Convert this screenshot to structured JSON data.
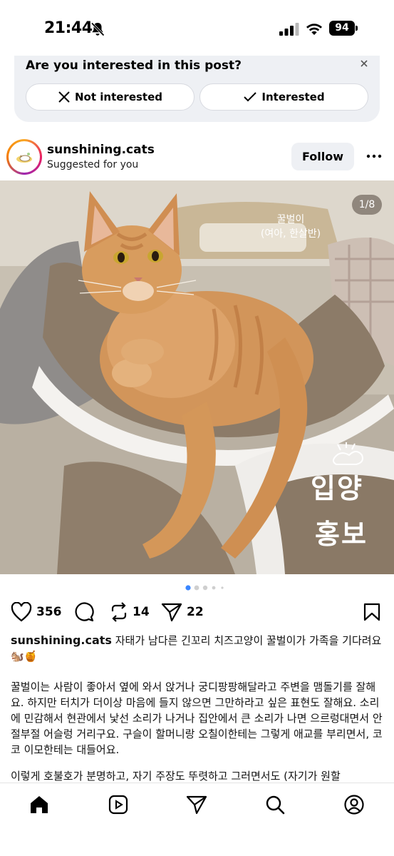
{
  "status_bar": {
    "time": "21:44",
    "battery": "94"
  },
  "interest_prompt": {
    "question": "Are you interested in this post?",
    "not_interested_label": "Not interested",
    "interested_label": "Interested"
  },
  "post": {
    "username": "sunshining.cats",
    "subtitle": "Suggested for you",
    "follow_label": "Follow",
    "image_counter": "1/8",
    "image_overlay": {
      "name_line1": "꿀벌이",
      "name_line2": "(여아, 한살반)",
      "tag_line1": "입양",
      "tag_line2": "홍보"
    },
    "carousel": {
      "current": 1,
      "total": 8
    },
    "stats": {
      "likes": "356",
      "reposts": "14",
      "shares": "22"
    },
    "caption": {
      "username": "sunshining.cats",
      "text": "자태가 남다른 긴꼬리 치즈고양이 꿀벌이가 가족을 기다려요 🐿️🍯",
      "body": "꿀벌이는 사람이 좋아서 옆에 와서 앉거나 궁디팡팡해달라고 주변을 맴돌기를 잘해요. 하지만 터치가 더이상 마음에 들지 않으면 그만하라고 싶은 표현도 잘해요. 소리에 민감해서 현관에서 낯선 소리가 나거나 집안에서 큰 소리가 나면 으르렁대면서 안절부절 어슬렁 거리구요. 구슬이 할머니랑 오칠이한테는 그렇게 애교를 부리면서, 코코 이모한테는 대들어요.",
      "more": "이렇게 호불호가 분명하고, 자기 주장도 뚜렷하고 그러면서도 (자기가 원할"
    }
  },
  "nav": {
    "items": [
      "home-icon",
      "reels-icon",
      "messages-icon",
      "search-icon",
      "profile-icon"
    ]
  }
}
